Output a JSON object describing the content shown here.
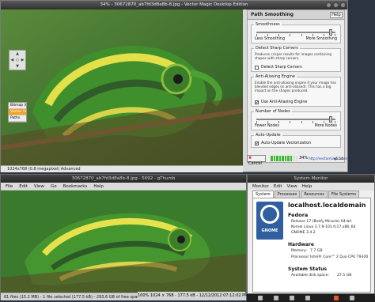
{
  "vm": {
    "title": "34% - 30672870_ab7fd3d8a8b-8.jpg - Vector Magic Desktop Edition",
    "status": "1024x768 (0.8 megapixel) Advanced",
    "nav_arrows": [
      "",
      "▲",
      "",
      "◀",
      "○",
      "▶",
      "",
      "▼",
      ""
    ],
    "view_toggle": [
      "Bitmap (B)",
      "Vector (V)",
      "Paths"
    ],
    "panel": {
      "title": "Path Smoothing",
      "help": "Help",
      "smoothness": {
        "title": "Smoothness",
        "left": "Less Smoothing",
        "right": "More Smoothing",
        "level": 0.94
      },
      "sharp": {
        "title": "Detect Sharp Corners",
        "desc": "Produces crisper results for images containing shapes with sharp corners.",
        "checkbox": "Detect Sharp Corners",
        "checked": false
      },
      "aa": {
        "title": "Anti-Aliasing Engine",
        "desc": "Enable the anti-aliasing engine if your image has blended edges (is anti-aliased). This has a big impact on the shapes produced.",
        "checkbox": "Use Anti-Aliasing Engine",
        "checked": true
      },
      "nodes": {
        "title": "Number of Nodes",
        "left": "Fewer Nodes",
        "right": "More Nodes",
        "level": 0.94
      },
      "autoupdate": {
        "title": "Auto-Update",
        "checkbox": "Auto-Update Vectorization",
        "checked": true
      }
    },
    "cancel": "Cancel",
    "progress_pct": "34%",
    "progress_value": 0.34,
    "link": "http://vectormagic.com",
    "version": "v1.14"
  },
  "gt": {
    "title": "30672870_ab7fd3d8a8b-8.jpg - 5692 - gThumb",
    "menu": [
      "File",
      "Edit",
      "View",
      "Go",
      "Bookmarks",
      "Help"
    ],
    "status_left": "61 files (15.2 MB) - 1 file selected (177.5 kB) - 293.6 GB of free space",
    "status_right": "100%   1024 × 768 - 177.5 kB - 12/12/2012 07:12:02 PM"
  },
  "sm": {
    "title": "System Monitor",
    "menu": [
      "Monitor",
      "Edit",
      "View",
      "Help"
    ],
    "tabs": [
      "System",
      "Processes",
      "Resources",
      "File Systems"
    ],
    "active_tab": 0,
    "hostname": "localhost.localdomain",
    "distro": "Fedora",
    "release": "Release 17 (Beefy Miracle) 64-bit",
    "kernel": "Kernel Linux 3.7.9-101.fc17.x86_64",
    "gnome_ver": "GNOME 3.4.2",
    "gnome_logo": "GNOME",
    "hardware_title": "Hardware",
    "memory_label": "Memory:",
    "memory_value": "7.7 GB",
    "processor_label": "Processor:",
    "processor_value": "Intel® Core™ 2 Duo CPU T9300",
    "status_title": "System Status",
    "disk_label": "Available disk space:",
    "disk_value": "27.5 GB"
  },
  "colors": {
    "accent": "#f4a223",
    "progress": "#3bbb2f",
    "fedora": "#2f5f9e"
  }
}
